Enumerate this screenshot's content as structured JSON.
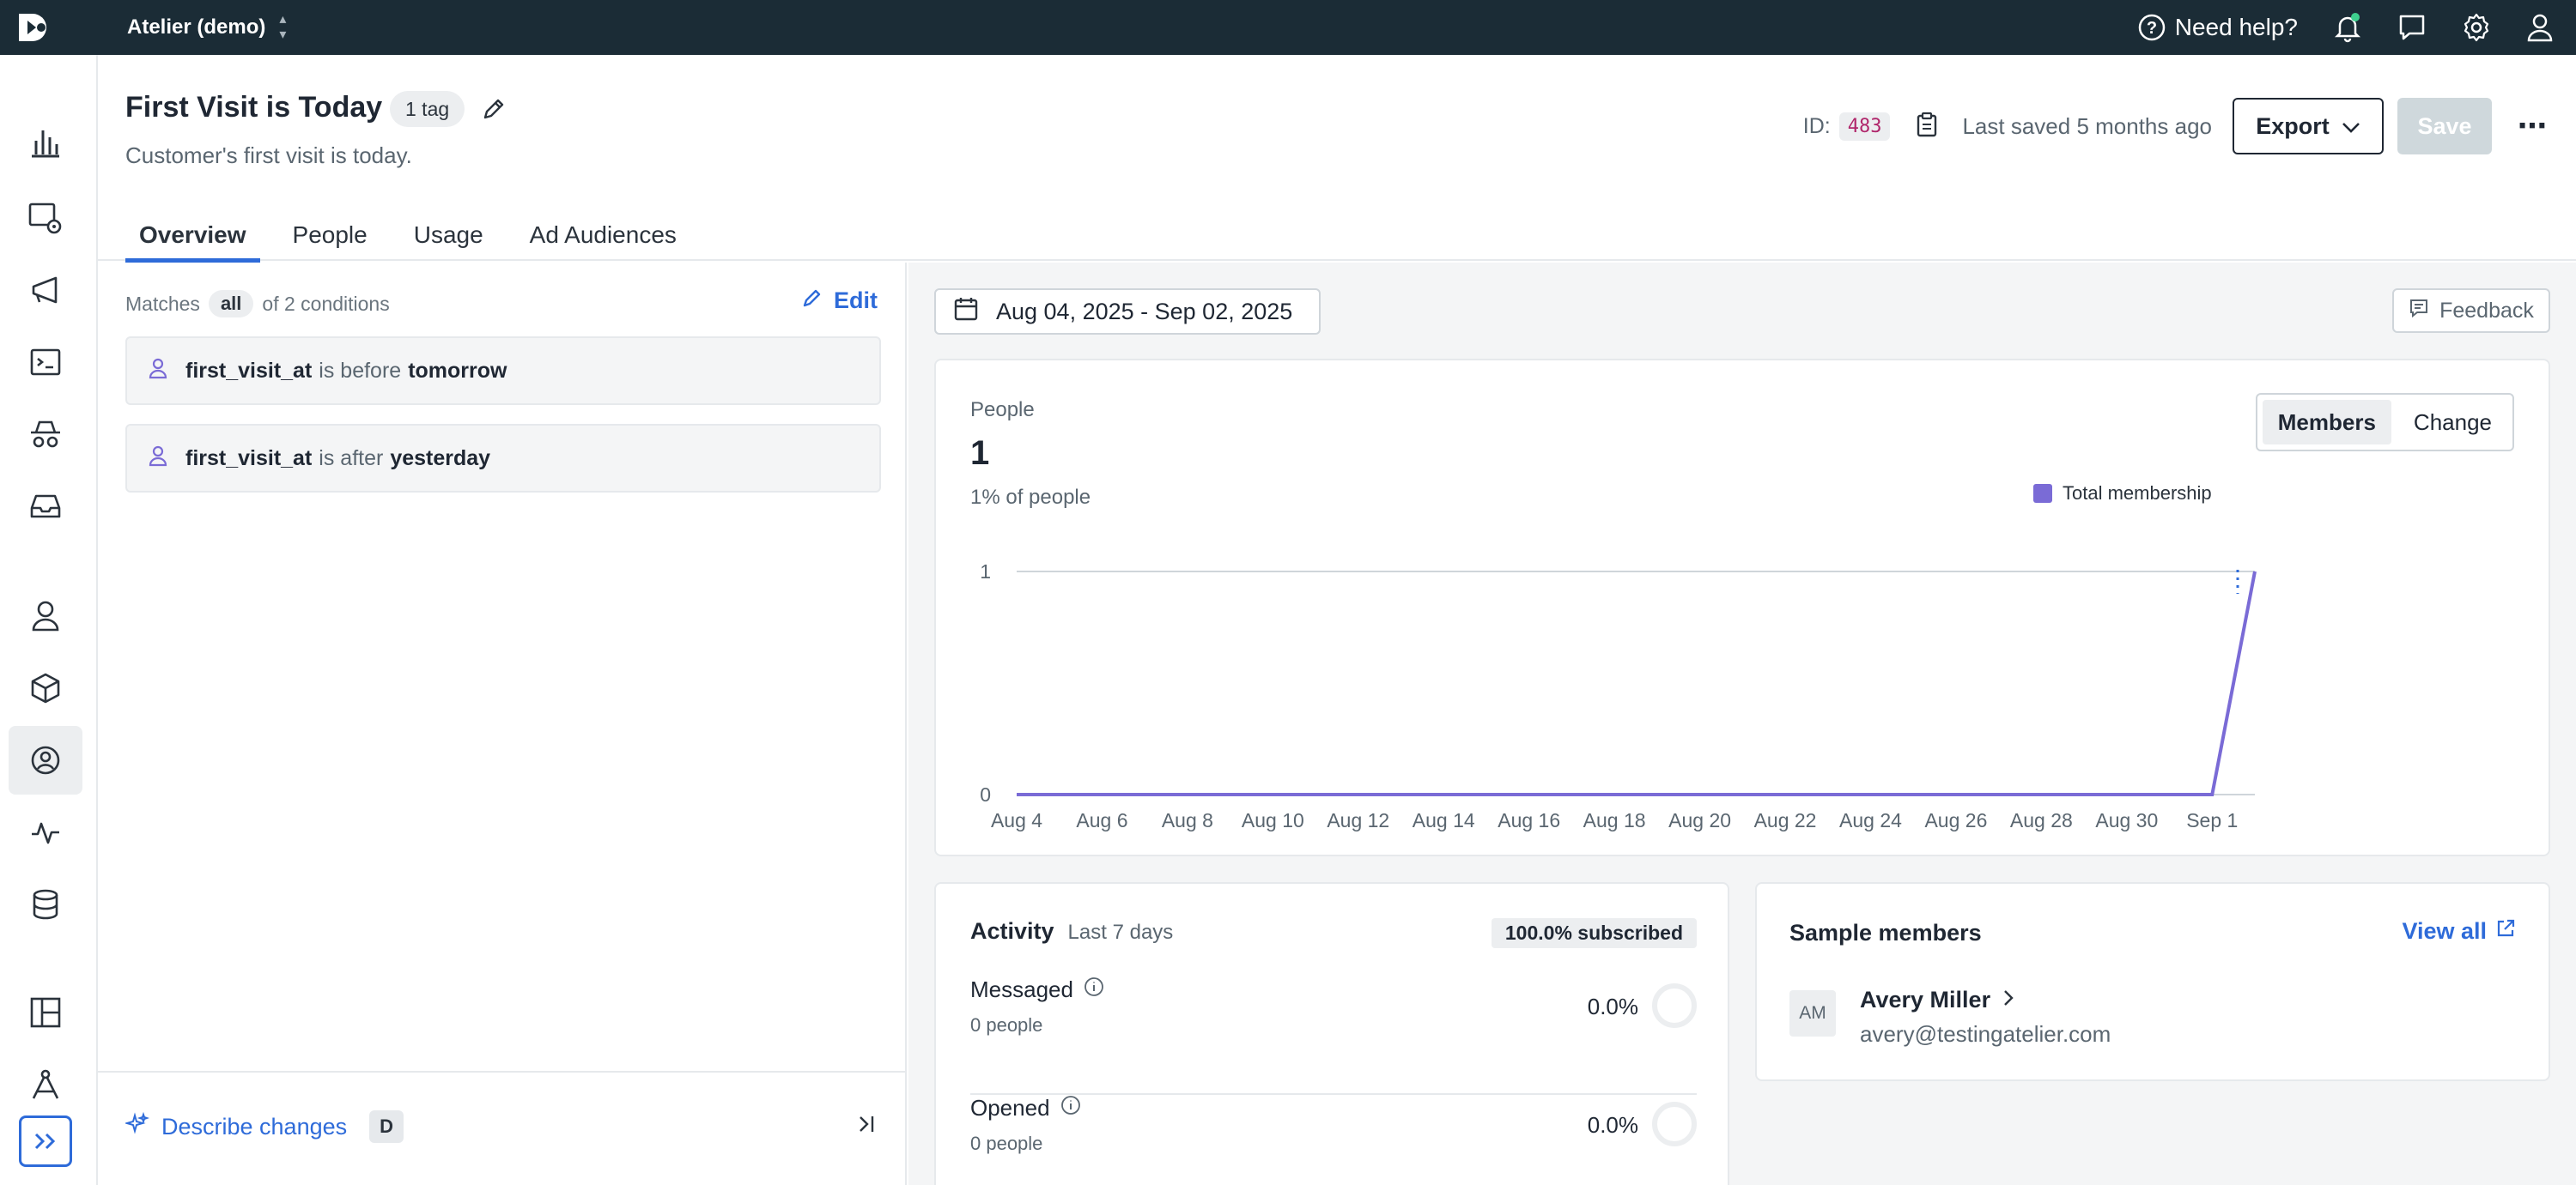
{
  "topbar": {
    "workspace": "Atelier (demo)",
    "help_label": "Need help?"
  },
  "segment": {
    "title": "First Visit is Today",
    "tag_label": "1 tag",
    "description": "Customer's first visit is today.",
    "id_label": "ID:",
    "id_value": "483",
    "last_saved": "Last saved 5 months ago",
    "export_label": "Export",
    "save_label": "Save"
  },
  "tabs": [
    "Overview",
    "People",
    "Usage",
    "Ad Audiences"
  ],
  "conditions": {
    "matches_label": "Matches",
    "mode": "all",
    "of_label": "of 2 conditions",
    "edit_label": "Edit",
    "items": [
      {
        "field": "first_visit_at",
        "op": "is before",
        "value": "tomorrow"
      },
      {
        "field": "first_visit_at",
        "op": "is after",
        "value": "yesterday"
      }
    ]
  },
  "describe": {
    "label": "Describe changes",
    "shortcut": "D"
  },
  "overview": {
    "date_range": "Aug 04, 2025 - Sep 02, 2025",
    "feedback_label": "Feedback",
    "people_label": "People",
    "people_count": "1",
    "people_pct": "1% of people",
    "toggle": [
      "Members",
      "Change"
    ],
    "toggle_selected": "Members"
  },
  "chart_data": {
    "type": "line",
    "series": [
      {
        "name": "Total membership",
        "color": "#7a6bd6",
        "x": [
          "Aug 4",
          "Aug 5",
          "Aug 6",
          "Aug 7",
          "Aug 8",
          "Aug 9",
          "Aug 10",
          "Aug 11",
          "Aug 12",
          "Aug 13",
          "Aug 14",
          "Aug 15",
          "Aug 16",
          "Aug 17",
          "Aug 18",
          "Aug 19",
          "Aug 20",
          "Aug 21",
          "Aug 22",
          "Aug 23",
          "Aug 24",
          "Aug 25",
          "Aug 26",
          "Aug 27",
          "Aug 28",
          "Aug 29",
          "Aug 30",
          "Aug 31",
          "Sep 1",
          "Sep 2"
        ],
        "values": [
          0,
          0,
          0,
          0,
          0,
          0,
          0,
          0,
          0,
          0,
          0,
          0,
          0,
          0,
          0,
          0,
          0,
          0,
          0,
          0,
          0,
          0,
          0,
          0,
          0,
          0,
          0,
          0,
          0,
          1
        ]
      }
    ],
    "x_ticks": [
      "Aug 4",
      "Aug 6",
      "Aug 8",
      "Aug 10",
      "Aug 12",
      "Aug 14",
      "Aug 16",
      "Aug 18",
      "Aug 20",
      "Aug 22",
      "Aug 24",
      "Aug 26",
      "Aug 28",
      "Aug 30",
      "Sep 1"
    ],
    "y_ticks": [
      "0",
      "1"
    ],
    "ylim": [
      0,
      1
    ],
    "grid": true,
    "legend_position": "top-right"
  },
  "activity": {
    "title": "Activity",
    "period": "Last 7 days",
    "subscribed": "100.0% subscribed",
    "metrics": [
      {
        "label": "Messaged",
        "people": "0 people",
        "value": "0.0%"
      },
      {
        "label": "Opened",
        "people": "0 people",
        "value": "0.0%"
      }
    ]
  },
  "sample": {
    "title": "Sample members",
    "view_all": "View all",
    "member": {
      "initials": "AM",
      "name": "Avery Miller",
      "email": "avery@testingatelier.com"
    }
  },
  "colors": {
    "accent": "#2e6bd9",
    "topbar": "#1b2c36",
    "series": "#7a6bd6",
    "notify_dot": "#3ecf8e"
  }
}
